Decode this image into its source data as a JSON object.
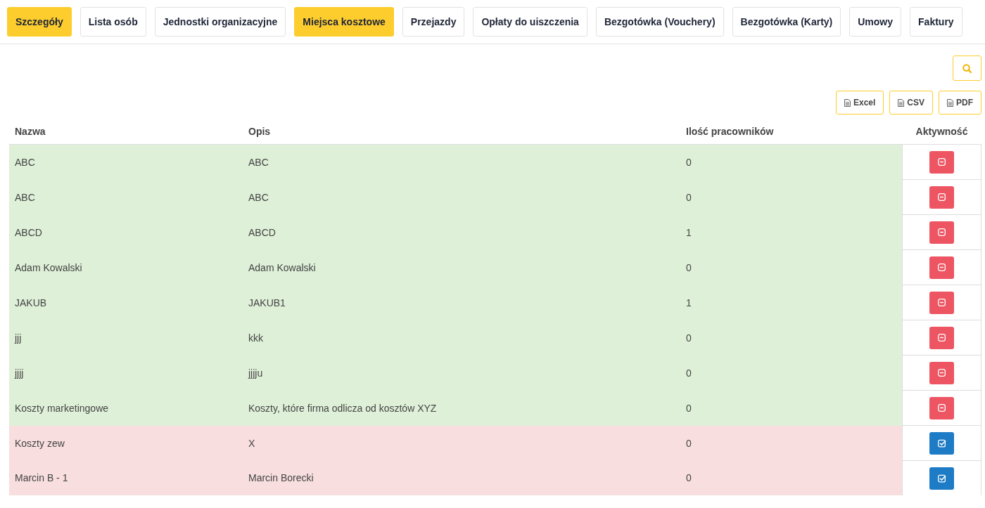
{
  "tabs": [
    {
      "label": "Szczegóły",
      "selected": true
    },
    {
      "label": "Lista osób",
      "selected": false
    },
    {
      "label": "Jednostki organizacyjne",
      "selected": false
    },
    {
      "label": "Miejsca kosztowe",
      "selected": true
    },
    {
      "label": "Przejazdy",
      "selected": false
    },
    {
      "label": "Opłaty do uiszczenia",
      "selected": false
    },
    {
      "label": "Bezgotówka (Vouchery)",
      "selected": false
    },
    {
      "label": "Bezgotówka (Karty)",
      "selected": false
    },
    {
      "label": "Umowy",
      "selected": false
    },
    {
      "label": "Faktury",
      "selected": false
    }
  ],
  "export_buttons": [
    "Excel",
    "CSV",
    "PDF"
  ],
  "table": {
    "columns": [
      "Nazwa",
      "Opis",
      "Ilość pracowników",
      "Aktywność"
    ],
    "rows": [
      {
        "name": "ABC",
        "description": "ABC",
        "employees": "0",
        "active": true
      },
      {
        "name": "ABC",
        "description": "ABC",
        "employees": "0",
        "active": true
      },
      {
        "name": "ABCD",
        "description": "ABCD",
        "employees": "1",
        "active": true
      },
      {
        "name": "Adam Kowalski",
        "description": "Adam Kowalski",
        "employees": "0",
        "active": true
      },
      {
        "name": "JAKUB",
        "description": "JAKUB1",
        "employees": "1",
        "active": true
      },
      {
        "name": "jjj",
        "description": "kkk",
        "employees": "0",
        "active": true
      },
      {
        "name": "jjjj",
        "description": "jjjju",
        "employees": "0",
        "active": true
      },
      {
        "name": "Koszty marketingowe",
        "description": "Koszty, które firma odlicza od kosztów XYZ",
        "employees": "0",
        "active": true
      },
      {
        "name": "Koszty zew",
        "description": "X",
        "employees": "0",
        "active": false
      },
      {
        "name": "Marcin B - 1",
        "description": "Marcin Borecki",
        "employees": "0",
        "active": false
      }
    ]
  }
}
